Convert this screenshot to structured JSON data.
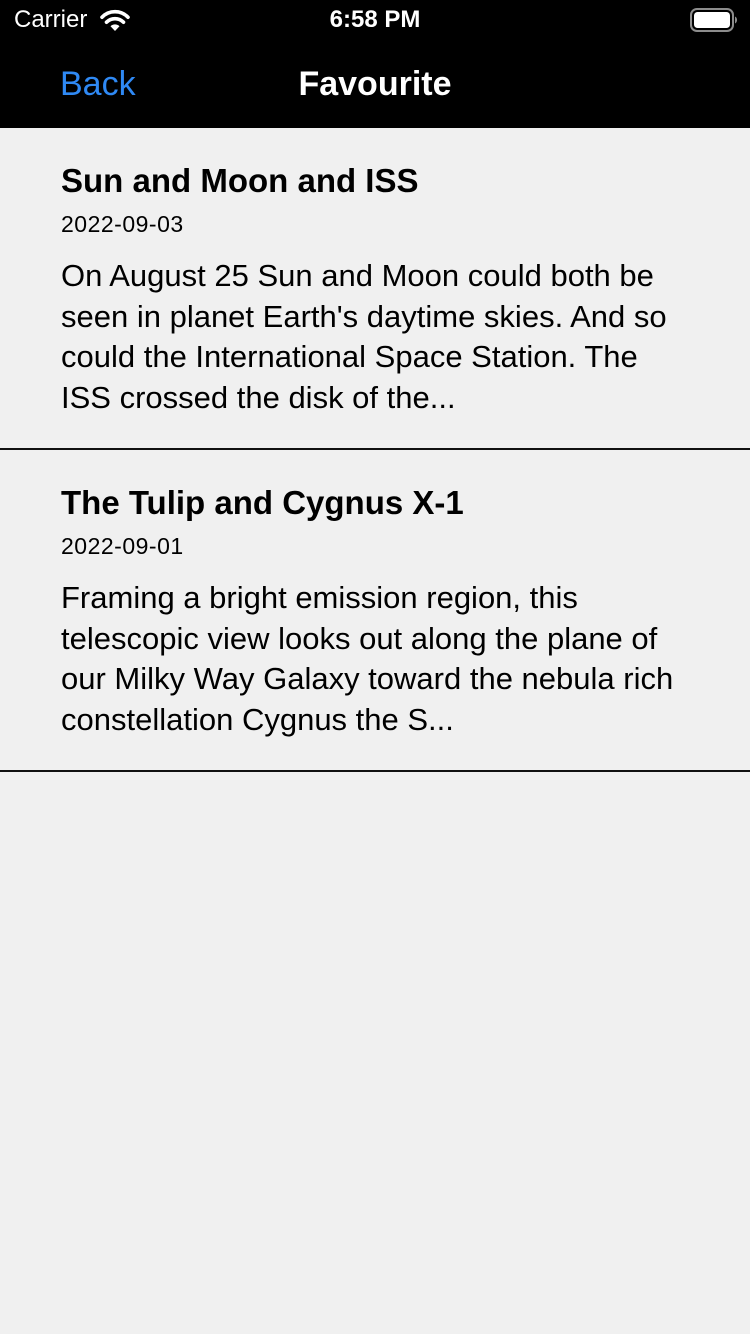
{
  "status_bar": {
    "carrier": "Carrier",
    "time": "6:58 PM",
    "wifi_icon": "wifi-icon",
    "battery_icon": "battery-icon"
  },
  "nav": {
    "back_label": "Back",
    "title": "Favourite",
    "accent_color": "#2f89f4"
  },
  "favourites": [
    {
      "title": "Sun and Moon and ISS",
      "date": "2022-09-03",
      "description": "On August 25 Sun and Moon could both be seen in planet Earth's daytime skies. And so could the International Space Station. The ISS crossed the disk of the..."
    },
    {
      "title": "The Tulip and Cygnus X-1",
      "date": "2022-09-01",
      "description": "Framing a bright emission region, this telescopic view looks out along the plane of our Milky Way Galaxy toward the nebula rich constellation Cygnus the S..."
    }
  ]
}
